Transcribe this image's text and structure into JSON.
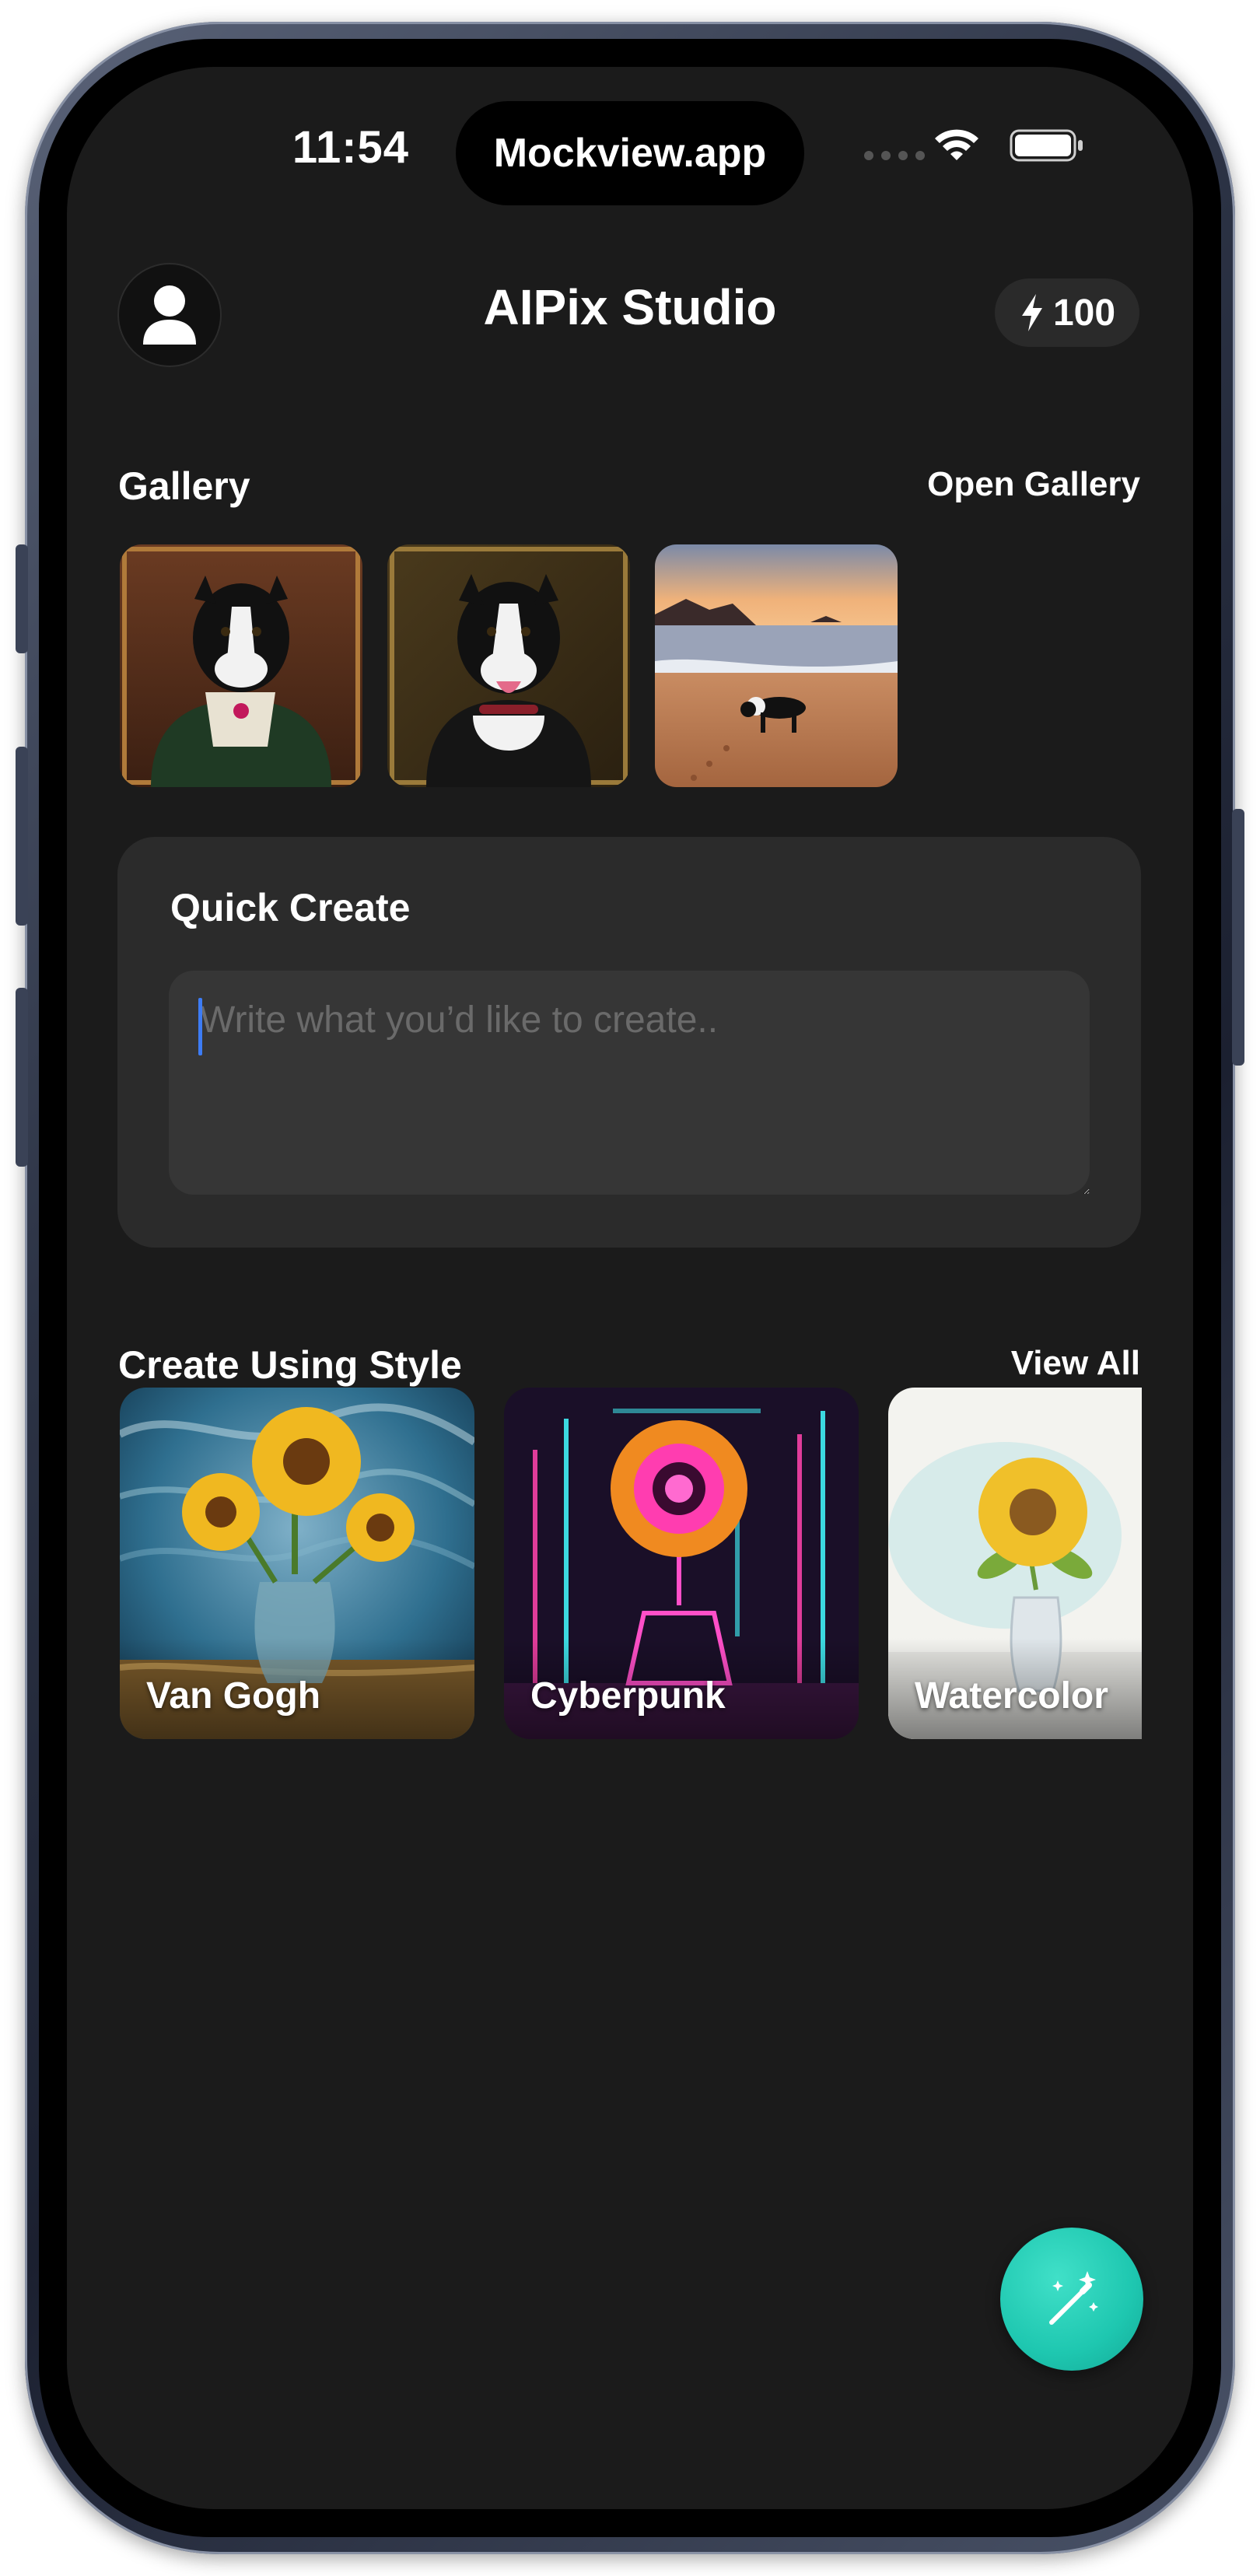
{
  "status": {
    "time": "11:54",
    "island_label": "Mockview.app"
  },
  "header": {
    "title": "AIPix Studio",
    "credits": "100"
  },
  "gallery": {
    "title": "Gallery",
    "link": "Open Gallery",
    "items": [
      "dog-portrait-victorian",
      "dog-portrait-collar",
      "dog-on-beach-sunset"
    ]
  },
  "quick_create": {
    "title": "Quick Create",
    "placeholder": "Write what you’d like to create.."
  },
  "styles": {
    "title": "Create Using Style",
    "link": "View All",
    "items": [
      {
        "label": "Van Gogh"
      },
      {
        "label": "Cyberpunk"
      },
      {
        "label": "Watercolor"
      }
    ]
  },
  "colors": {
    "accent": "#1ec7b0",
    "background": "#1b1b1b",
    "card": "#2b2b2b"
  },
  "icons": {
    "avatar": "user-icon",
    "credits": "bolt-icon",
    "fab": "magic-wand-icon",
    "wifi": "wifi-icon",
    "battery": "battery-icon"
  }
}
